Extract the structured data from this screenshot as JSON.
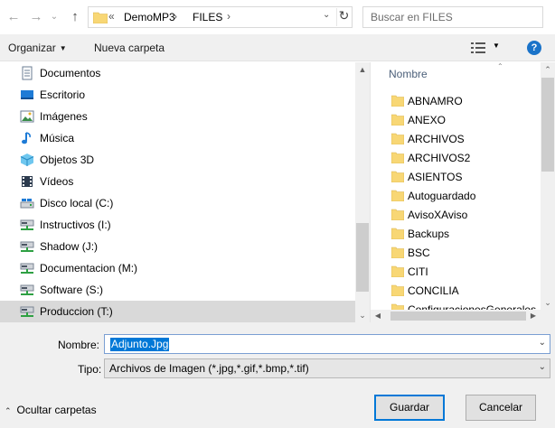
{
  "address": {
    "overflow": "«",
    "crumbs": [
      "DemoMP3",
      "FILES"
    ],
    "search_placeholder": "Buscar en FILES"
  },
  "toolbar": {
    "organize_label": "Organizar",
    "new_folder_label": "Nueva carpeta"
  },
  "nav": {
    "items": [
      {
        "label": "Documentos",
        "icon": "documents-icon"
      },
      {
        "label": "Escritorio",
        "icon": "desktop-icon"
      },
      {
        "label": "Imágenes",
        "icon": "pictures-icon"
      },
      {
        "label": "Música",
        "icon": "music-icon"
      },
      {
        "label": "Objetos 3D",
        "icon": "3d-objects-icon"
      },
      {
        "label": "Vídeos",
        "icon": "videos-icon"
      },
      {
        "label": "Disco local (C:)",
        "icon": "local-disk-icon"
      },
      {
        "label": "Instructivos (I:)",
        "icon": "network-drive-icon"
      },
      {
        "label": "Shadow (J:)",
        "icon": "network-drive-icon"
      },
      {
        "label": "Documentacion (M:)",
        "icon": "network-drive-icon"
      },
      {
        "label": "Software (S:)",
        "icon": "network-drive-icon"
      },
      {
        "label": "Produccion (T:)",
        "icon": "network-drive-icon",
        "selected": true
      }
    ]
  },
  "content": {
    "column_header": "Nombre",
    "folders": [
      "ABNAMRO",
      "ANEXO",
      "ARCHIVOS",
      "ARCHIVOS2",
      "ASIENTOS",
      "Autoguardado",
      "AvisoXAviso",
      "Backups",
      "BSC",
      "CITI",
      "CONCILIA",
      "ConfiguracionesGenerales"
    ]
  },
  "bottom": {
    "filename_label": "Nombre:",
    "filename_value": "Adjunto.Jpg",
    "type_label": "Tipo:",
    "type_value": "Archivos de Imagen (*.jpg,*.gif,*.bmp,*.tif)",
    "hide_folders_label": "Ocultar carpetas",
    "save_label": "Guardar",
    "cancel_label": "Cancelar"
  },
  "colors": {
    "folder": "#f8d775",
    "accent": "#0078d7",
    "selected_row": "#d9d9d9"
  }
}
